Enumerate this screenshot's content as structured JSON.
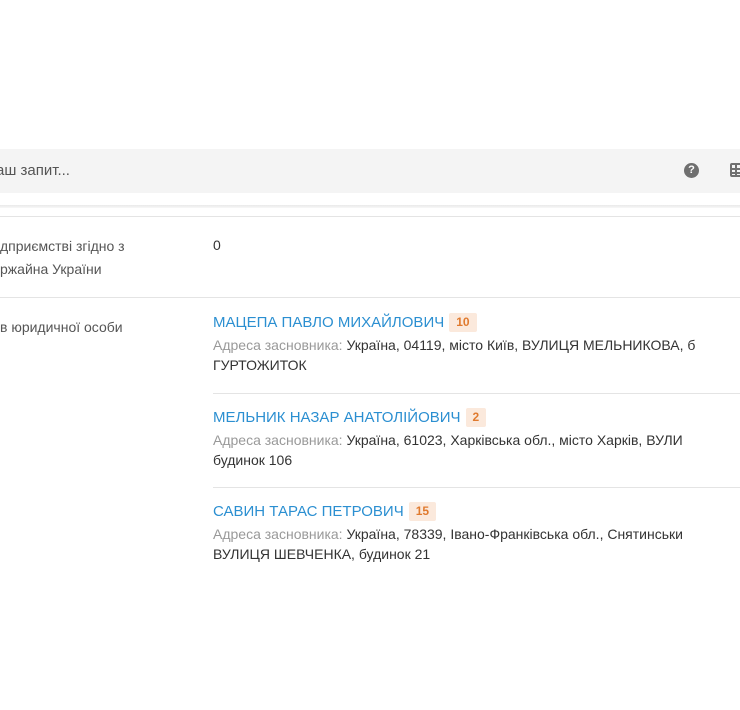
{
  "search": {
    "placeholder": "аш запит..."
  },
  "icons": {
    "help": "question-circle-icon",
    "grid": "table-icon"
  },
  "rows": [
    {
      "label_line1": "дприємстві згідно з",
      "label_line2": "ржайна України",
      "value": "0"
    },
    {
      "label_line1": "в юридичної особи"
    }
  ],
  "founders": [
    {
      "name": "МАЦЕПА ПАВЛО МИХАЙЛОВИЧ",
      "count": "10",
      "address_label": "Адреса засновника:",
      "address_line1": "Україна, 04119, місто Київ, ВУЛИЦЯ МЕЛЬНИКОВА, б",
      "address_line2": "ГУРТОЖИТОК"
    },
    {
      "name": "МЕЛЬНИК НАЗАР АНАТОЛІЙОВИЧ",
      "count": "2",
      "address_label": "Адреса засновника:",
      "address_line1": "Україна, 61023, Харківська обл., місто Харків, ВУЛИ",
      "address_line2": "будинок 106"
    },
    {
      "name": "САВИН ТАРАС ПЕТРОВИЧ",
      "count": "15",
      "address_label": "Адреса засновника:",
      "address_line1": "Україна, 78339, Івано-Франківська обл., Снятинськи",
      "address_line2": "ВУЛИЦЯ ШЕВЧЕНКА, будинок 21"
    }
  ],
  "colors": {
    "link": "#2b8fd1",
    "badge_text": "#e07a2e",
    "badge_bg": "#fbe9dc"
  }
}
